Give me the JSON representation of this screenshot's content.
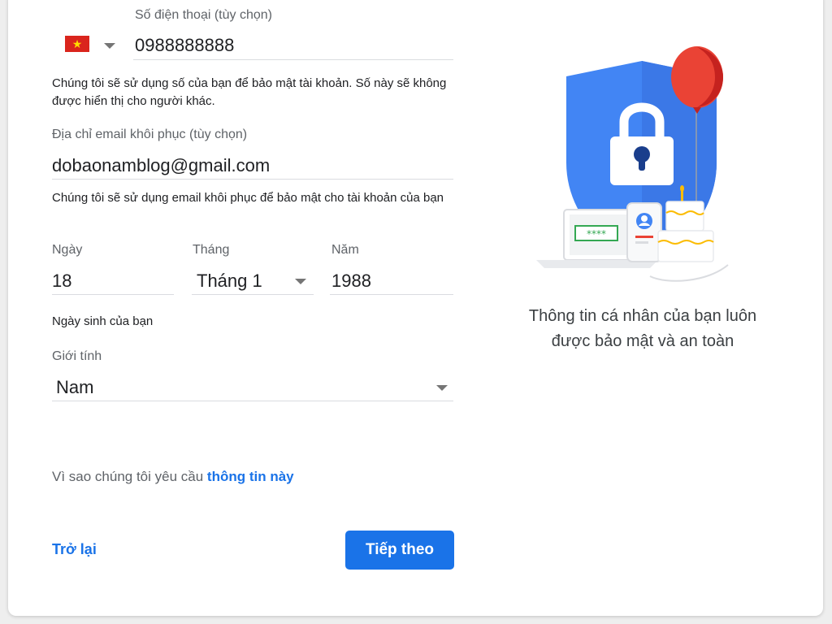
{
  "phone": {
    "label": "Số điện thoại (tùy chọn)",
    "country_flag_icon": "vietnam-flag-icon",
    "value": "0988888888",
    "help": "Chúng tôi sẽ sử dụng số của bạn để bảo mật tài khoản. Số này sẽ không được hiển thị cho người khác."
  },
  "recovery_email": {
    "label": "Địa chỉ email khôi phục (tùy chọn)",
    "value": "dobaonamblog@gmail.com",
    "help": "Chúng tôi sẽ sử dụng email khôi phục để bảo mật cho tài khoản của bạn"
  },
  "birthday": {
    "day_label": "Ngày",
    "day_value": "18",
    "month_label": "Tháng",
    "month_value": "Tháng 1",
    "year_label": "Năm",
    "year_value": "1988",
    "help": "Ngày sinh của bạn"
  },
  "gender": {
    "label": "Giới tính",
    "value": "Nam"
  },
  "why": {
    "prefix": "Vì sao chúng tôi yêu cầu",
    "link": "thông tin này"
  },
  "actions": {
    "back_label": "Trở lại",
    "next_label": "Tiếp theo"
  },
  "illustration": {
    "pin_text": "****",
    "caption_line1": "Thông tin cá nhân của bạn luôn",
    "caption_line2": "được bảo mật và an toàn"
  },
  "colors": {
    "accent": "#1a73e8",
    "shield": "#4285f4",
    "balloon": "#ea4335"
  }
}
